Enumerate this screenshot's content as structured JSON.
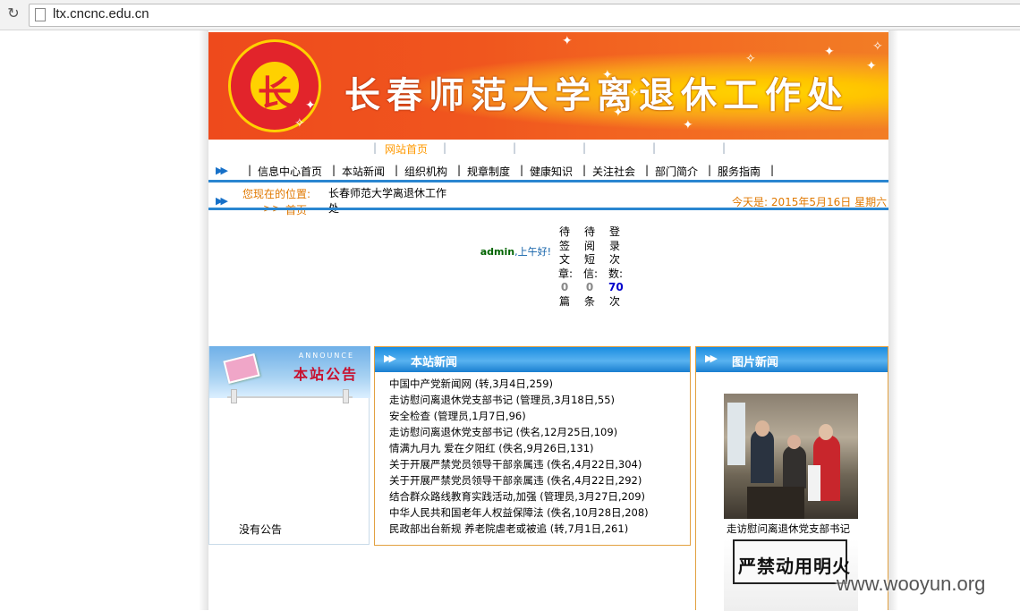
{
  "browser": {
    "url": "ltx.cncnc.edu.cn"
  },
  "banner": {
    "title": "长春师范大学离退休工作处",
    "seal_char": "长"
  },
  "top_links": {
    "home": "网站首页"
  },
  "nav": {
    "items": [
      "信息中心首页",
      "本站新闻",
      "组织机构",
      "规章制度",
      "健康知识",
      "关注社会",
      "部门简介",
      "服务指南"
    ]
  },
  "location": {
    "label": "您现在的位置:",
    "site": "长春师范大学离退休工作处",
    "separator": ">>",
    "current": "首页",
    "today": "今天是: 2015年5月16日 星期六"
  },
  "user": {
    "name": "admin",
    "greeting": ",上午好!",
    "stats": [
      {
        "label": "待签文章:",
        "value": "0",
        "unit": "篇"
      },
      {
        "label": "待阅短信:",
        "value": "0",
        "unit": "条"
      },
      {
        "label": "登录次数:",
        "value": "70",
        "unit": "次"
      }
    ]
  },
  "announce": {
    "en": "ANNOUNCE",
    "title": "本站公告",
    "empty": "没有公告"
  },
  "news": {
    "title": "本站新闻",
    "items": [
      "中国中产党新闻网 (转,3月4日,259)",
      "走访慰问离退休党支部书记 (管理员,3月18日,55)",
      "安全检查 (管理员,1月7日,96)",
      "走访慰问离退休党支部书记 (佚名,12月25日,109)",
      "情满九月九 爱在夕阳红 (佚名,9月26日,131)",
      "关于开展严禁党员领导干部亲属违 (佚名,4月22日,304)",
      "关于开展严禁党员领导干部亲属违 (佚名,4月22日,292)",
      "结合群众路线教育实践活动,加强 (管理员,3月27日,209)",
      "中华人民共和国老年人权益保障法 (佚名,10月28日,208)",
      "民政部出台新规 养老院虐老或被追 (转,7月1日,261)"
    ]
  },
  "pictures": {
    "title": "图片新闻",
    "caption1": "走访慰问离退休党支部书记",
    "sign_text": "严禁动用明火"
  },
  "watermark": "www.wooyun.org",
  "colors": {
    "accent_orange": "#e07800",
    "link_blue": "#1060a8",
    "rule_blue": "#2a86d0",
    "panel_border": "#e2a040"
  }
}
